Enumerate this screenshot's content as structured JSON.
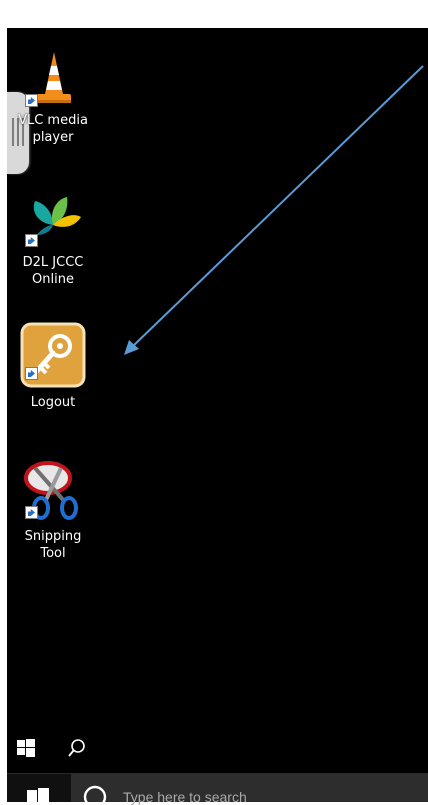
{
  "desktop": {
    "icons": [
      {
        "label_line1": "VLC media",
        "label_line2": "player",
        "icon": "vlc-cone-icon"
      },
      {
        "label_line1": "D2L JCCC",
        "label_line2": "Online",
        "icon": "d2l-leaf-icon"
      },
      {
        "label_line1": "Logout",
        "icon": "key-icon"
      },
      {
        "label_line1": "Snipping",
        "label_line2": "Tool",
        "icon": "scissors-icon"
      }
    ],
    "annotation": "arrow pointing to Logout icon"
  },
  "taskbar": {
    "search_placeholder": "Type here to search",
    "start_icon": "windows-logo-icon",
    "search_icon": "magnifier-icon"
  },
  "colors": {
    "desktop_bg": "#000000",
    "arrow": "#5b9bd5",
    "logout_tile": "#e0a23c",
    "vlc_orange": "#f28c1b"
  }
}
